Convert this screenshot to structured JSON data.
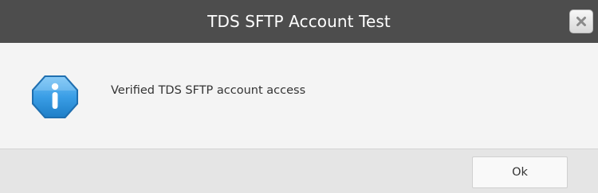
{
  "dialog": {
    "title": "TDS SFTP Account Test",
    "close_icon": "close-icon",
    "message": "Verified TDS SFTP account access",
    "message_icon": "info-icon",
    "ok_label": "Ok"
  },
  "colors": {
    "titlebar": "#4d4d4d",
    "body": "#f4f4f4",
    "footer": "#e5e5e5",
    "info_icon": "#3d9de0"
  }
}
